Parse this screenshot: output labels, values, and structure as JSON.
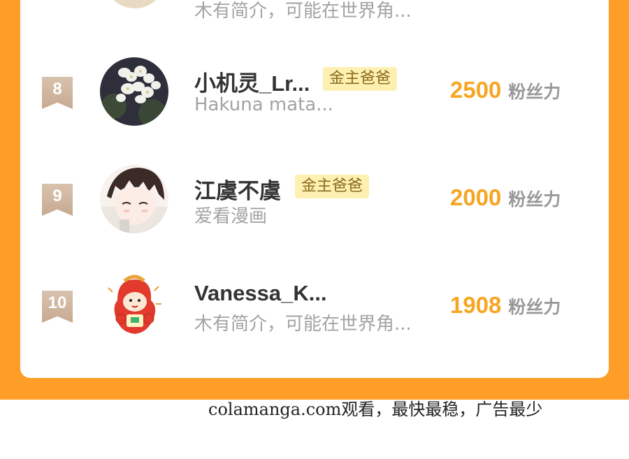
{
  "ranking": {
    "fans_unit": "粉丝力",
    "rows": [
      {
        "rank": "",
        "name": "",
        "badge": "",
        "bio": "木有简介，可能在世界角...",
        "fans": ""
      },
      {
        "rank": "8",
        "name": "小机灵_Lr...",
        "badge": "金主爸爸",
        "bio": "Hakuna mata...",
        "fans": "2500"
      },
      {
        "rank": "9",
        "name": "江虞不虞",
        "badge": "金主爸爸",
        "bio": "爱看漫画",
        "fans": "2000"
      },
      {
        "rank": "10",
        "name": "Vanessa_K...",
        "badge": "",
        "bio": "木有简介，可能在世界角...",
        "fans": "1908"
      }
    ]
  },
  "watermark": "colamanga.com观看，最快最稳，广告最少",
  "colors": {
    "frame": "#FE9D27",
    "fans_count": "#F6A623",
    "badge_bg": "#FEF0B0",
    "rank_ribbon": "#C7AA91"
  },
  "icons": {
    "rank_marker": "ribbon-bookmark-icon",
    "avatar_8": "white-flowers-photo",
    "avatar_9": "anime-boy-portrait",
    "avatar_10": "red-mascot-sticker"
  }
}
